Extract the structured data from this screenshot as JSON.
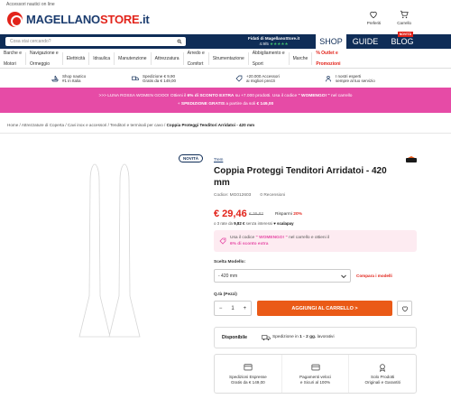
{
  "header": {
    "topline": "Accessori nautici on line",
    "logo_main": "MAGELLANO",
    "logo_store": "STORE",
    "logo_tld": ".it",
    "wishlist_label": "Preferiti",
    "cart_label": "Carrello"
  },
  "bluebar": {
    "search_placeholder": "Cosa stai cercando?",
    "trust_title": "Fidati di MagellanoStore.it",
    "trust_rating": "4.9/5",
    "trust_stars": "★★★★★",
    "tab_shop": "SHOP",
    "tab_guide": "GUIDE",
    "tab_blog": "BLOG",
    "blog_badge": "NOVITÀ"
  },
  "categories": [
    {
      "line1": "Barche e",
      "line2": "Motori"
    },
    {
      "line1": "Navigazione e",
      "line2": "Ormeggio"
    },
    {
      "line1": "Elettricità",
      "line2": ""
    },
    {
      "line1": "Idraulica",
      "line2": ""
    },
    {
      "line1": "Manutenzione",
      "line2": ""
    },
    {
      "line1": "Attrezzatura",
      "line2": ""
    },
    {
      "line1": "Arredo e",
      "line2": "Comfort"
    },
    {
      "line1": "Strumentazione",
      "line2": ""
    },
    {
      "line1": "Abbigliamento e",
      "line2": "Sport"
    },
    {
      "line1": "Marche",
      "line2": ""
    },
    {
      "line1": "% Outlet e",
      "line2": "Promozioni"
    }
  ],
  "benefits": [
    {
      "line1": "Shop nautico",
      "line2": "#1 in Italia"
    },
    {
      "line1": "Spedizione € 9,90",
      "line2": "Gratis da € 149,00"
    },
    {
      "line1": "+20.000 Accessori",
      "line2": "ai migliori prezzi"
    },
    {
      "line1": "I nostri esperti",
      "line2": "sempre al tuo servizio"
    }
  ],
  "promo": {
    "line1_a": ">>> LUNA ROSSA WOMEN GOOO! Ottieni il ",
    "line1_b": "6% di SCONTO EXTRA",
    "line1_c": " su +7.000 prodotti. Usa il codice ",
    "line1_d": "\" WOMENGO! \"",
    "line1_e": " nel carrello",
    "line2_a": "+ ",
    "line2_b": "SPEDIZIONE GRATIS",
    "line2_c": " a partire da soli ",
    "line2_d": "€ 149,00"
  },
  "breadcrumb": {
    "path": "Home / Attrezzature di Coperta / Cavi inox e accessori / Tenditori e terminali per cavo / ",
    "current": "Coppia Proteggi Tenditori Arridatoi - 420 mm"
  },
  "product": {
    "badge": "NOVITÀ",
    "brand": "Trem",
    "title": "Coppia Proteggi Tenditori Arridatoi - 420 mm",
    "code": "Codice: MG012603",
    "reviews": "0 Recensioni",
    "price": "€ 29,46",
    "old_price": "€ 36,82",
    "save_label": "Risparmi",
    "save_pct": "20%",
    "installments_a": "o 3 rate da ",
    "installments_b": "9,82 €",
    "installments_c": " senza interessi",
    "scalapay": "scalapay",
    "coupon_a": "Usa il codice ",
    "coupon_code": "\" WOMENGO! \"",
    "coupon_b": " nel carrello e ottieni il",
    "coupon_c": "6% di sconto extra",
    "model_label": "Scelta Modello:",
    "model_value": "- 420 mm",
    "compare_label": "Compara i modelli",
    "qty_label": "Q.tà (Pezzi)",
    "qty_minus": "−",
    "qty_value": "1",
    "qty_plus": "+",
    "cart_button": "AGGIUNGI AL CARRELLO >",
    "availability_label": "Disponibile",
    "ship_a": "Spedizione in ",
    "ship_b": "1 - 2 gg.",
    "ship_c": " lavorativi"
  },
  "features": [
    {
      "line1": "Spedizioni Espresse",
      "line2": "Gratis da € 149,00"
    },
    {
      "line1": "Pagamenti veloci",
      "line2": "e Sicuri al 100%"
    },
    {
      "line1": "Solo Prodotti",
      "line2": "Originali e Garantiti"
    }
  ],
  "colors": {
    "brand_navy": "#0f2d57",
    "brand_red": "#e2231a",
    "promo_pink": "#e64ba6",
    "cta_orange": "#ea5a17"
  }
}
